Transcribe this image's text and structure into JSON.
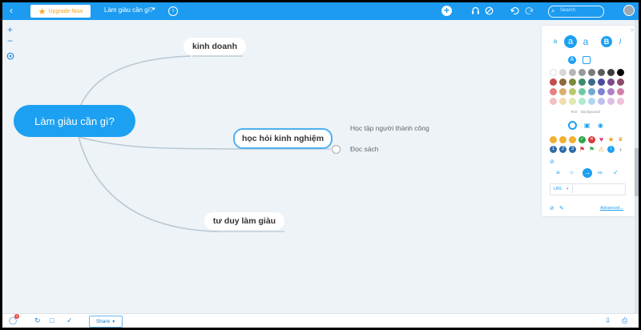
{
  "topbar": {
    "upgrade_label": "Upgrade Now",
    "map_title": "Làm giàu cần gì?",
    "search_placeholder": "Search"
  },
  "mindmap": {
    "root": "Làm giàu cần gì?",
    "branches": [
      {
        "label": "kinh doanh"
      },
      {
        "label": "học hỏi kinh nghiệm",
        "children": [
          "Học tập người thành công",
          "Đọc sách"
        ]
      },
      {
        "label": "tư duy làm giàu"
      }
    ]
  },
  "panel": {
    "font_small": "a",
    "font_medium": "a",
    "font_large": "a",
    "bold": "B",
    "italic": "I",
    "text_label": "Text",
    "background_label": "Background",
    "url_label": "URL",
    "advanced_label": "Advanced...",
    "text_colors": [
      "#ffffff",
      "#d8d8d8",
      "#b6b6b6",
      "#999999",
      "#7b7b7b",
      "#5c5c5c",
      "#3c3c3c",
      "#000000"
    ],
    "bg_colors": [
      "#c44c4c",
      "#8b6a3c",
      "#7a8b3c",
      "#3c8b6a",
      "#3c6a8b",
      "#4a4aa3",
      "#7a4a8b",
      "#8b4a6a",
      "#e88080",
      "#d9b070",
      "#b7c870",
      "#70c8a0",
      "#70a8d0",
      "#8080d8",
      "#b080c8",
      "#d080a8",
      "#f4c0c0",
      "#f0dcb0",
      "#e0e8b0",
      "#b0e8d0",
      "#b0d8f0",
      "#c0c0f0",
      "#dcc0e8",
      "#f0c0dc"
    ]
  },
  "bottombar": {
    "share_label": "Share",
    "notification_count": "1"
  }
}
